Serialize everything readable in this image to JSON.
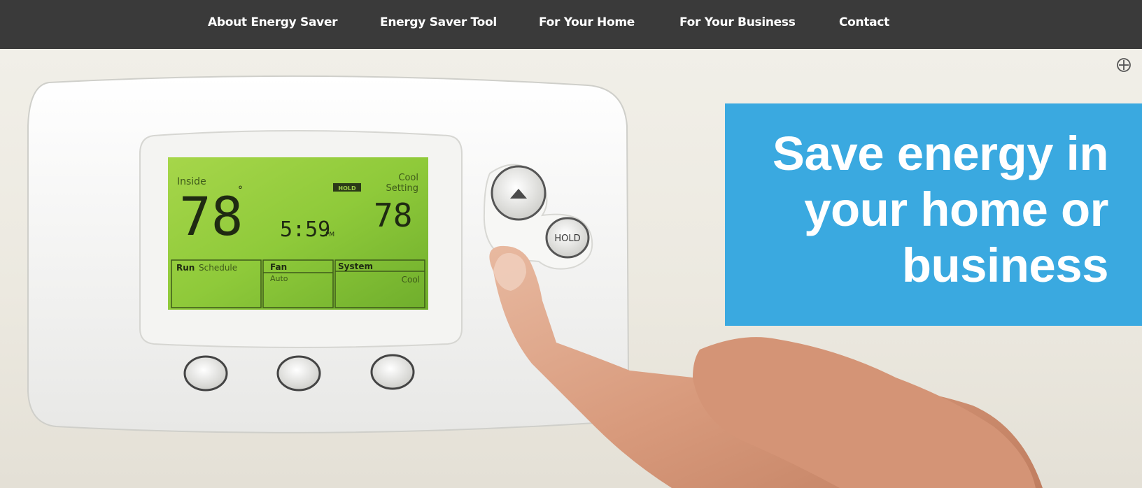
{
  "nav": {
    "items": [
      {
        "label": "About Energy Saver"
      },
      {
        "label": "Energy Saver Tool"
      },
      {
        "label": "For Your Home"
      },
      {
        "label": "For Your Business"
      },
      {
        "label": "Contact"
      }
    ]
  },
  "hero": {
    "headline": "Save energy in your home or business",
    "zoom_icon": "zoom-target-icon",
    "thermostat": {
      "inside_label": "Inside",
      "inside_temp": "78",
      "hold_badge": "HOLD",
      "cool_label": "Cool",
      "setting_label": "Setting",
      "set_temp": "78",
      "time": "5:59",
      "time_suffix": "PM",
      "run_label": "Run",
      "schedule_label": "Schedule",
      "fan_label": "Fan",
      "fan_value": "Auto",
      "system_label": "System",
      "system_value": "Cool",
      "hold_button": "HOLD"
    }
  },
  "colors": {
    "nav_bg": "#3a3a3a",
    "banner_bg": "#3aa9e0",
    "lcd": "#8dc93c"
  }
}
